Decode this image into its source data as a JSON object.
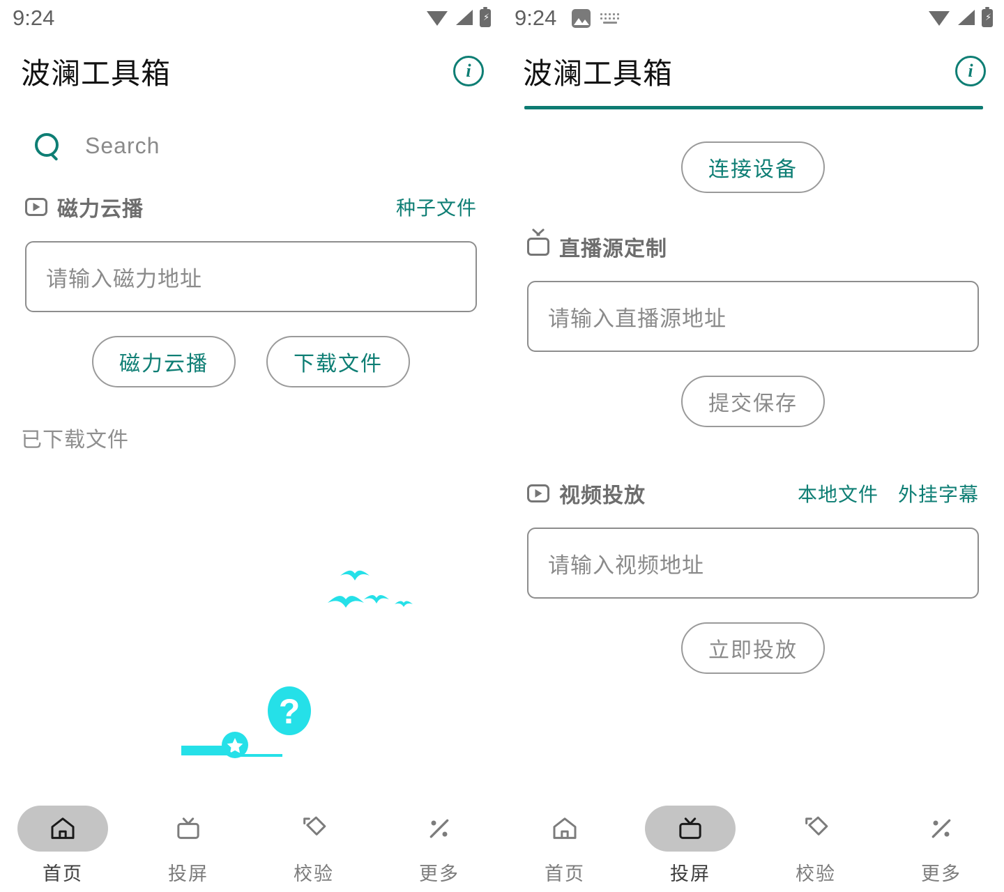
{
  "accent": {
    "teal": "#0e7e74",
    "cyan": "#25E0E8",
    "gray_text": "#8a8a8a",
    "active_pill": "#c4c4c4"
  },
  "screens": [
    {
      "status_bar": {
        "time": "9:24",
        "left_icons": [],
        "right_icons": [
          "wifi-icon",
          "signal-icon",
          "battery-charging-icon"
        ]
      },
      "app_bar": {
        "title": "波澜工具箱",
        "info_icon": "info-icon",
        "divider": false
      },
      "search": {
        "icon": "search-icon",
        "placeholder": "Search",
        "value": ""
      },
      "sections": [
        {
          "icon": "play-box-icon",
          "title": "磁力云播",
          "links": [
            "种子文件"
          ],
          "input": {
            "placeholder": "请输入磁力地址",
            "value": ""
          },
          "buttons": [
            {
              "label": "磁力云播",
              "style": "teal"
            },
            {
              "label": "下载文件",
              "style": "teal"
            }
          ]
        }
      ],
      "downloaded_label": "已下载文件",
      "empty_state": {
        "illustration": "question-mark-empty-illustration",
        "question_glyph": "?"
      },
      "bottom_nav": {
        "active_index": 0,
        "items": [
          {
            "icon": "home-icon",
            "label": "首页"
          },
          {
            "icon": "tv-icon",
            "label": "投屏"
          },
          {
            "icon": "verify-tag-icon",
            "label": "校验"
          },
          {
            "icon": "percent-icon",
            "label": "更多"
          }
        ]
      }
    },
    {
      "status_bar": {
        "time": "9:24",
        "left_icons": [
          "screenshot-image-icon",
          "keyboard-icon"
        ],
        "right_icons": [
          "wifi-icon",
          "signal-icon",
          "battery-charging-icon"
        ]
      },
      "app_bar": {
        "title": "波澜工具箱",
        "info_icon": "info-icon",
        "divider": true
      },
      "connect": {
        "label": "连接设备",
        "style": "teal"
      },
      "sections": [
        {
          "icon": "tv-icon",
          "title": "直播源定制",
          "links": [],
          "input": {
            "placeholder": "请输入直播源地址",
            "value": ""
          },
          "buttons": [
            {
              "label": "提交保存",
              "style": "gray"
            }
          ]
        },
        {
          "icon": "play-box-icon",
          "title": "视频投放",
          "links": [
            "本地文件",
            "外挂字幕"
          ],
          "input": {
            "placeholder": "请输入视频地址",
            "value": ""
          },
          "buttons": [
            {
              "label": "立即投放",
              "style": "gray"
            }
          ]
        }
      ],
      "bottom_nav": {
        "active_index": 1,
        "items": [
          {
            "icon": "home-icon",
            "label": "首页"
          },
          {
            "icon": "tv-icon",
            "label": "投屏"
          },
          {
            "icon": "verify-tag-icon",
            "label": "校验"
          },
          {
            "icon": "percent-icon",
            "label": "更多"
          }
        ]
      }
    }
  ]
}
